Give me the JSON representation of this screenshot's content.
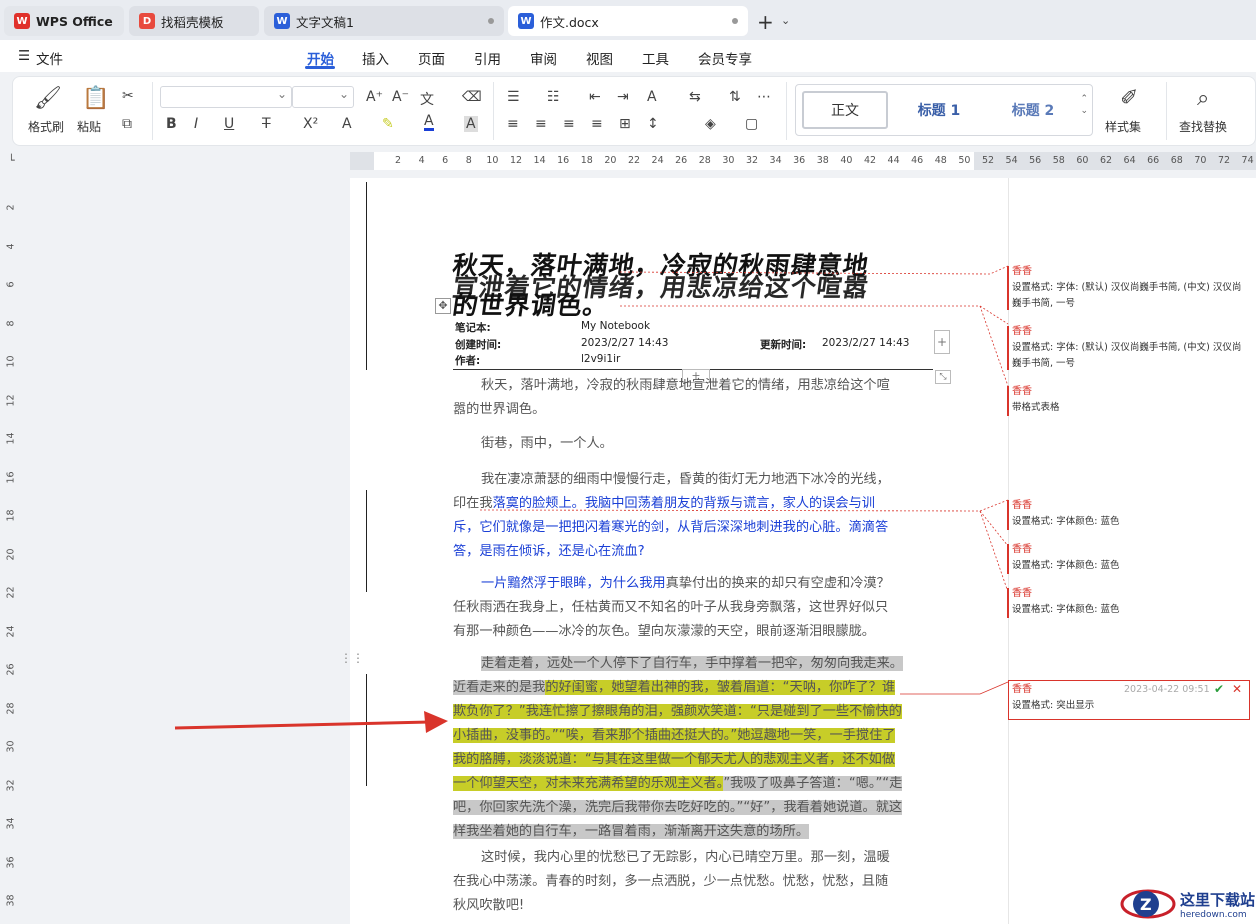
{
  "tabs": [
    {
      "label": "WPS Office",
      "icon": "wps-logo-icon"
    },
    {
      "label": "找稻壳模板",
      "icon": "docer-icon"
    },
    {
      "label": "文字文稿1",
      "icon": "word-doc-icon"
    },
    {
      "label": "作文.docx",
      "icon": "word-doc-icon"
    }
  ],
  "menu": {
    "file": "文件",
    "items": [
      "开始",
      "插入",
      "页面",
      "引用",
      "审阅",
      "视图",
      "工具",
      "会员专享"
    ]
  },
  "ribbon": {
    "format_painter": "格式刷",
    "paste": "粘贴",
    "styles": [
      "正文",
      "标题 1",
      "标题 2"
    ],
    "style_set": "样式集",
    "find_replace": "查找替换"
  },
  "ruler": {
    "h_ticks": [
      "2",
      "4",
      "6",
      "8",
      "10",
      "12",
      "14",
      "16",
      "18",
      "20",
      "22",
      "24",
      "26",
      "28",
      "30",
      "32",
      "34",
      "36",
      "38",
      "40",
      "42",
      "44",
      "46",
      "48",
      "50",
      "52",
      "54",
      "56",
      "58",
      "60",
      "62",
      "64",
      "66",
      "68",
      "70",
      "72",
      "74"
    ],
    "v_ticks": [
      "2",
      "4",
      "6",
      "8",
      "10",
      "12",
      "14",
      "16",
      "18",
      "20",
      "22",
      "24",
      "26",
      "28",
      "30",
      "32",
      "34",
      "36",
      "38"
    ]
  },
  "doc": {
    "title_line1": "秋天，落叶满地，冷寂的秋雨肆意地",
    "title_line2": "宣泄着它的情绪，用悲凉给这个喧嚣",
    "title_line3": "的世界调色。",
    "meta": {
      "notebook_label": "笔记本:",
      "notebook_value": "My Notebook",
      "created_label": "创建时间:",
      "created_value": "2023/2/27 14:43",
      "updated_label": "更新时间:",
      "updated_value": "2023/2/27 14:43",
      "author_label": "作者:",
      "author_value": "l2v9i1ir"
    },
    "p1": "秋天，落叶满地，冷寂的秋雨肆意地宣泄着它的情绪，用悲凉给这个喧嚣的世界调色。",
    "p2": "街巷，雨中，一个人。",
    "p3a": "我在凄凉萧瑟的细雨中慢慢行走，昏黄的街灯无力地洒下冰冷的光线，印在我",
    "p3b": "落寞的脸颊上。我脑中回荡着朋友的背叛与谎言，家人的误会与训斥，它们就像是一把把闪着寒光的剑，从背后深深地刺进我的心脏。滴滴答答，是雨在倾诉，还是心在流血?",
    "p4a": "一片黯然浮于眼眸，为什么我用",
    "p4b": "真挚付出的换来的却只有空虚和冷漠？任秋雨洒在我身上，任枯黄而又不知名的叶子从我身旁飘落，这世界好似只有那一种颜色——冰冷的灰色。望向灰濛濛的天空，眼前逐渐泪眼朦胧。",
    "p5a": "走着走着，远处一个人停下了自行车，手中撑着一把伞，匆匆向我走来。近看走来的是我",
    "p5b": "的好闺蜜，她望着出神的我，皱着眉道：“天呐，你咋了？谁欺负你了？”我连忙擦了擦眼角的泪，强颜欢笑道：“只是碰到了一些不愉快的小插曲，没事的。”“唉，看来那个插曲还挺大的。”她逗趣地一笑，一手搅住了我的胳膊，淡淡说道：“与其在这里做一个郁天尤人的悲观主义者，还不如做一个仰望天空，对未来充满希望的乐观主义者。",
    "p5c": "”我吸了吸鼻子答道：“嗯。”“走吧，你回家先洗个澡，洗完后我带你去吃好吃的。”“好”，我看着她说道。就这样我坐着她的自行车，一路冒着雨，渐渐离开这失意的场所。",
    "p6": "这时候，我内心里的忧愁已了无踪影，内心已晴空万里。那一刻，温暖在我心中荡漾。青春的时刻，多一点洒脱，少一点忧愁。忧愁，忧愁，且随秋风吹散吧!"
  },
  "comments": [
    {
      "author": "香香",
      "text": "设置格式: 字体: (默认) 汉仪尚巍手书简, (中文) 汉仪尚巍手书简, 一号"
    },
    {
      "author": "香香",
      "text": "设置格式: 字体: (默认) 汉仪尚巍手书简, (中文) 汉仪尚巍手书简, 一号"
    },
    {
      "author": "香香",
      "text": "带格式表格"
    },
    {
      "author": "香香",
      "text": "设置格式: 字体颜色: 蓝色"
    },
    {
      "author": "香香",
      "text": "设置格式: 字体颜色: 蓝色"
    },
    {
      "author": "香香",
      "text": "设置格式: 字体颜色: 蓝色"
    },
    {
      "author": "香香",
      "text": "设置格式: 突出显示",
      "time": "2023-04-22 09:51"
    }
  ],
  "watermark": {
    "title": "这里下载站",
    "url": "heredown.com"
  },
  "colors": {
    "accent": "#2b5fd9",
    "revision": "#d9342b",
    "highlight": "#c7cd28",
    "shade": "#c8c8c8",
    "blue_text": "#1a3fd6"
  }
}
